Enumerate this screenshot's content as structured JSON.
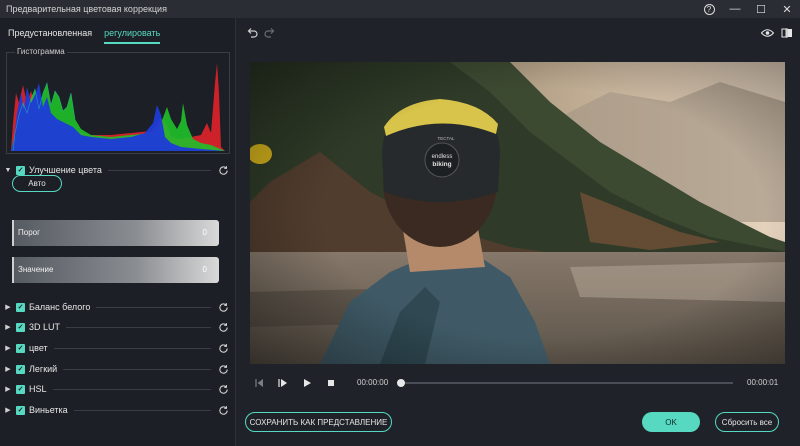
{
  "window": {
    "title": "Предварительная цветовая коррекция",
    "help_glyph": "?",
    "minimize_glyph": "—",
    "maximize_glyph": "☐",
    "close_glyph": "✕"
  },
  "tabs": [
    {
      "label": "Предустановленная",
      "active": false
    },
    {
      "label": "регулировать",
      "active": true
    }
  ],
  "histogram": {
    "label": "Гистограмма",
    "channels": [
      "red",
      "green",
      "blue"
    ]
  },
  "color_enhancement": {
    "label": "Улучшение цвета",
    "expanded": true,
    "checked": true,
    "auto_label": "Авто",
    "threshold_label": "Порог",
    "threshold_value": "0",
    "amount_label": "Значение",
    "amount_value": "0"
  },
  "sections": [
    {
      "label": "Баланс белого",
      "checked": true
    },
    {
      "label": "3D LUT",
      "checked": true
    },
    {
      "label": "цвет",
      "checked": true
    },
    {
      "label": "Легкий",
      "checked": true
    },
    {
      "label": "HSL",
      "checked": true
    },
    {
      "label": "Виньетка",
      "checked": true
    }
  ],
  "buttons": {
    "save_preset": "СОХРАНИТЬ КАК ПРЕДСТАВЛЕНИЕ",
    "ok": "OK",
    "reset_all": "Сбросить все"
  },
  "player": {
    "current_time": "00:00:00",
    "total_time": "00:00:01",
    "progress": 0
  },
  "preview_texts": {
    "helmet_line1": "endless",
    "helmet_line2": "biking",
    "helmet_brand": "TECTAL"
  },
  "colors": {
    "accent": "#56d9c0",
    "background": "#1f2229",
    "panel": "#1c1f25"
  }
}
